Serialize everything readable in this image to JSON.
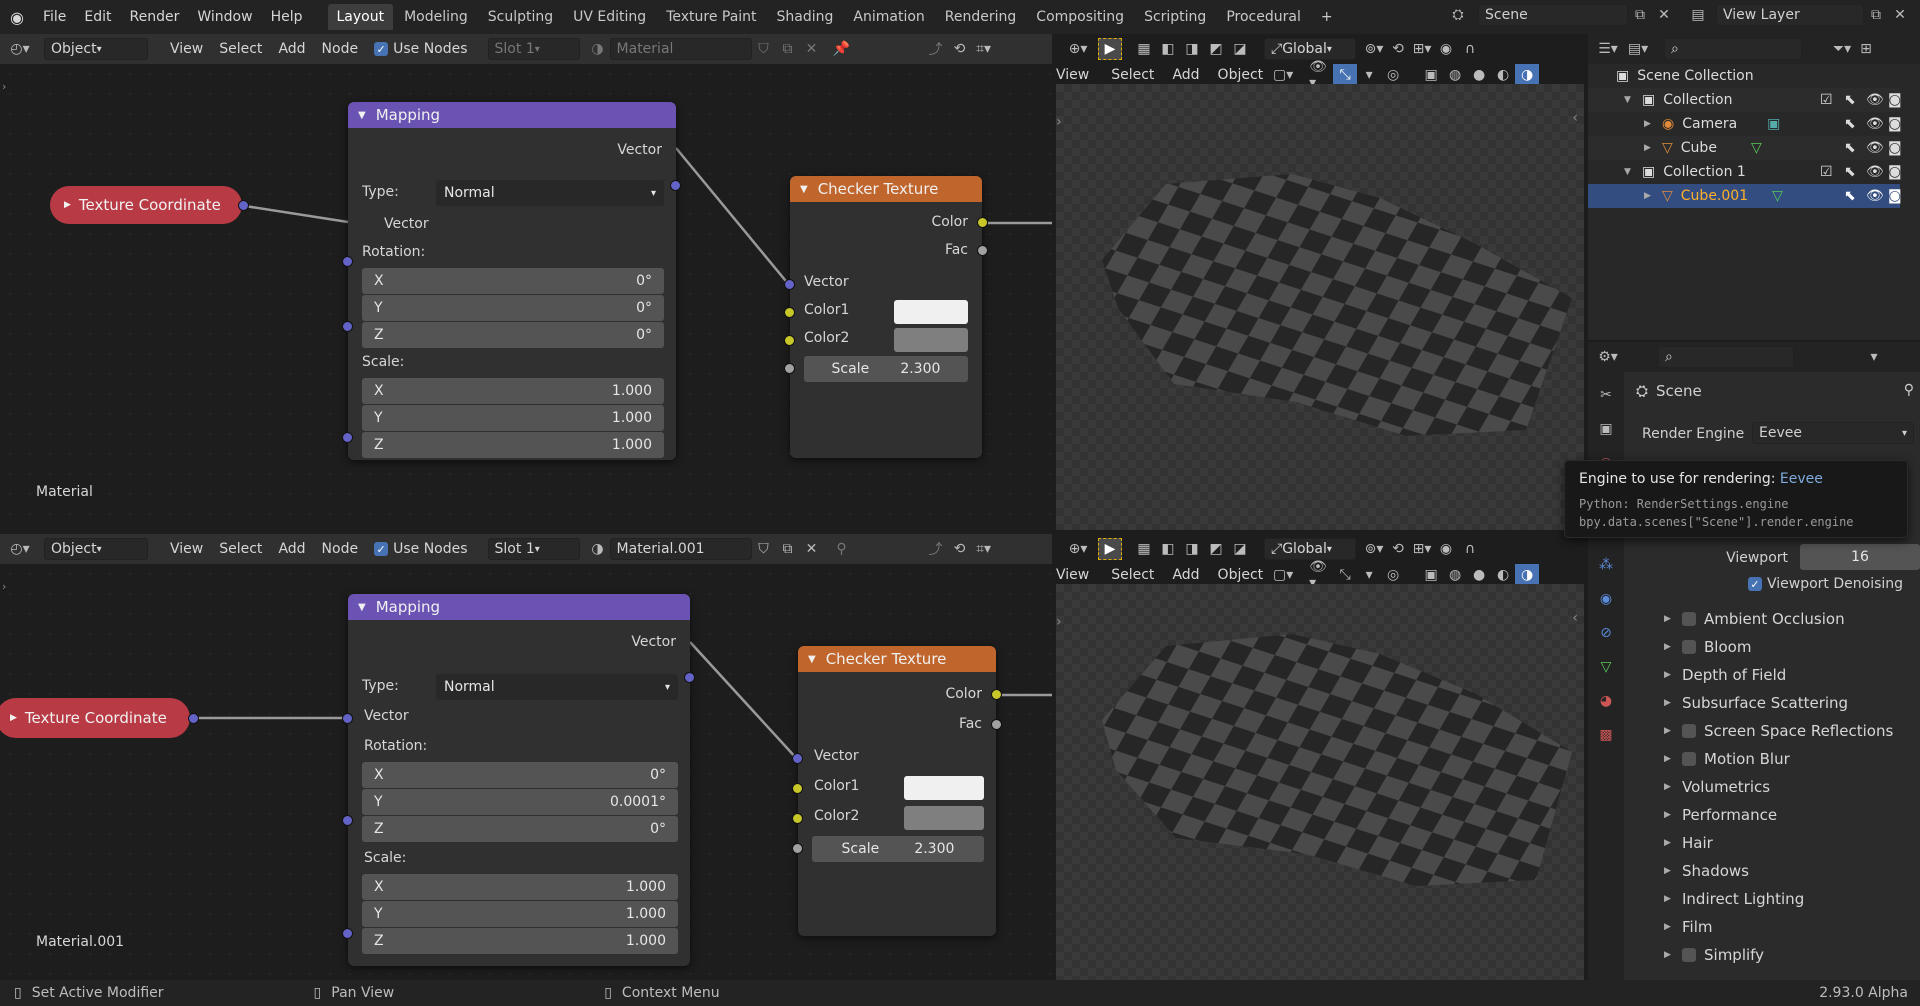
{
  "topbar": {
    "menus": [
      "File",
      "Edit",
      "Render",
      "Window",
      "Help"
    ],
    "workspaces": [
      "Layout",
      "Modeling",
      "Sculpting",
      "UV Editing",
      "Texture Paint",
      "Shading",
      "Animation",
      "Rendering",
      "Compositing",
      "Scripting",
      "Procedural"
    ],
    "active_workspace": "Layout",
    "scene": "Scene",
    "view_layer": "View Layer"
  },
  "node_editor_top": {
    "mode": "Object",
    "menus": [
      "View",
      "Select",
      "Add",
      "Node"
    ],
    "use_nodes": "Use Nodes",
    "slot": "Slot 1",
    "material": "Material",
    "material_label": "Material",
    "texcoord": "Texture Coordinate",
    "mapping": {
      "title": "Mapping",
      "out_vector": "Vector",
      "type_label": "Type:",
      "type": "Normal",
      "in_vector": "Vector",
      "rotation": "Rotation:",
      "rx": "0°",
      "ry": "0°",
      "rz": "0°",
      "scale": "Scale:",
      "sx": "1.000",
      "sy": "1.000",
      "sz": "1.000"
    },
    "checker": {
      "title": "Checker Texture",
      "color": "Color",
      "fac": "Fac",
      "vector": "Vector",
      "color1": "Color1",
      "color2": "Color2",
      "scale_label": "Scale",
      "scale": "2.300"
    }
  },
  "node_editor_bottom": {
    "mode": "Object",
    "menus": [
      "View",
      "Select",
      "Add",
      "Node"
    ],
    "use_nodes": "Use Nodes",
    "slot": "Slot 1",
    "material": "Material.001",
    "material_label": "Material.001",
    "texcoord": "Texture Coordinate",
    "mapping": {
      "title": "Mapping",
      "out_vector": "Vector",
      "type_label": "Type:",
      "type": "Normal",
      "in_vector": "Vector",
      "rotation": "Rotation:",
      "rx": "0°",
      "ry": "0.0001°",
      "rz": "0°",
      "scale": "Scale:",
      "sx": "1.000",
      "sy": "1.000",
      "sz": "1.000"
    },
    "checker": {
      "title": "Checker Texture",
      "color": "Color",
      "fac": "Fac",
      "vector": "Vector",
      "color1": "Color1",
      "color2": "Color2",
      "scale_label": "Scale",
      "scale": "2.300"
    }
  },
  "viewport_header": {
    "menus": [
      "View",
      "Select",
      "Add",
      "Object"
    ],
    "orientation": "Global"
  },
  "outliner": {
    "rows": [
      {
        "label": "Scene Collection",
        "indent": 0
      },
      {
        "label": "Collection",
        "indent": 1
      },
      {
        "label": "Camera",
        "indent": 2
      },
      {
        "label": "Cube",
        "indent": 2
      },
      {
        "label": "Collection 1",
        "indent": 1
      },
      {
        "label": "Cube.001",
        "indent": 2
      }
    ]
  },
  "properties": {
    "context": "Scene",
    "render_engine_label": "Render Engine",
    "render_engine": "Eevee",
    "tooltip": {
      "title": "Engine to use for rendering:",
      "value": "Eevee",
      "python1": "Python: RenderSettings.engine",
      "python2": "bpy.data.scenes[\"Scene\"].render.engine"
    },
    "viewport_label": "Viewport",
    "viewport_value": "16",
    "denoise": "Viewport Denoising",
    "panels": [
      "Ambient Occlusion",
      "Bloom",
      "Depth of Field",
      "Subsurface Scattering",
      "Screen Space Reflections",
      "Motion Blur",
      "Volumetrics",
      "Performance",
      "Hair",
      "Shadows",
      "Indirect Lighting",
      "Film",
      "Simplify"
    ]
  },
  "statusbar": {
    "left": "Set Active Modifier",
    "mid": "Pan View",
    "right": "Context Menu",
    "version": "2.93.0 Alpha"
  },
  "colors": {
    "accent": "#4772b3",
    "mapping_header": "#6b53b3",
    "checker_header": "#c0652c",
    "texcoord": "#b83a45",
    "selected_row": "#334d80"
  }
}
